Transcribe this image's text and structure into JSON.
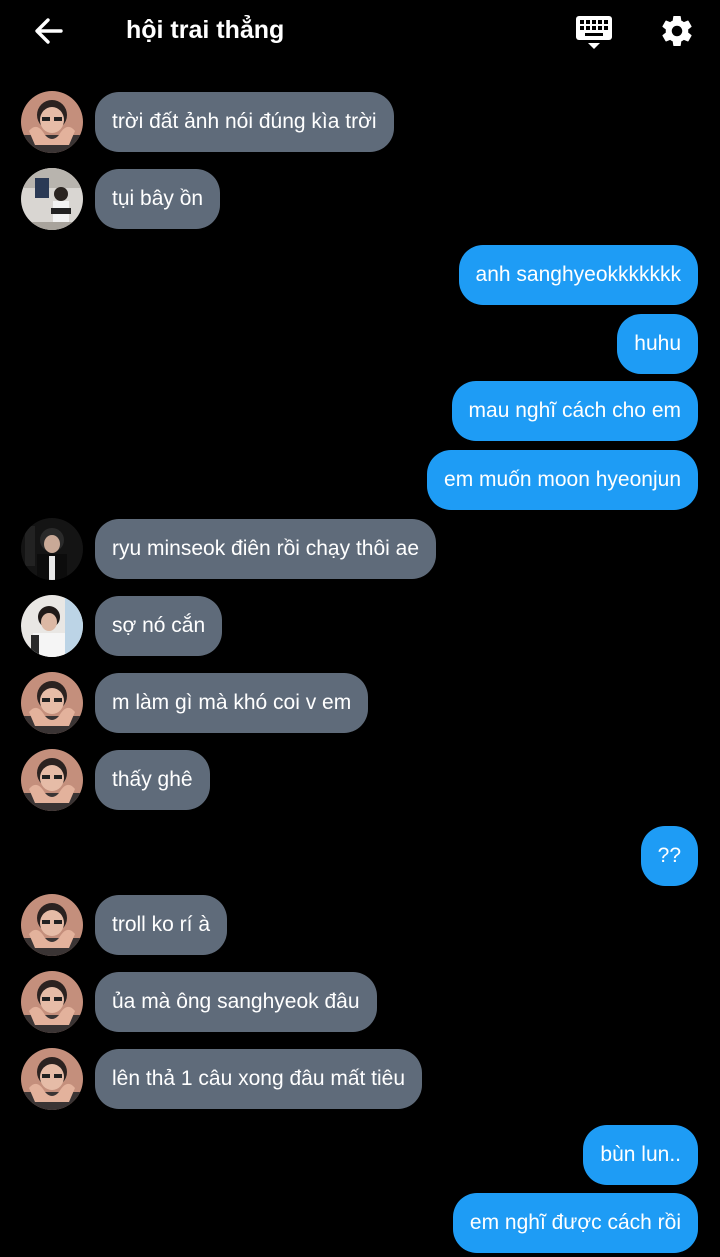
{
  "header": {
    "title": "hội trai thẳng",
    "back_icon": "arrow-left-icon",
    "keyboard_icon": "keyboard-icon",
    "settings_icon": "gear-icon"
  },
  "colors": {
    "background": "#000000",
    "incoming_bubble": "#5f6b7a",
    "outgoing_bubble": "#1e9cf5",
    "text": "#ffffff"
  },
  "messages": [
    {
      "direction": "in",
      "text": "trời đất ảnh nói đúng kìa trời",
      "avatar": "avatar-heart-hands"
    },
    {
      "direction": "in",
      "text": "tụi bây ồn",
      "avatar": "avatar-f1-store"
    },
    {
      "direction": "out",
      "text": "anh sanghyeokkkkkkk"
    },
    {
      "direction": "out",
      "text": "huhu"
    },
    {
      "direction": "out",
      "text": "mau nghĩ cách cho em"
    },
    {
      "direction": "out",
      "text": "em muốn moon hyeonjun"
    },
    {
      "direction": "in",
      "text": "ryu minseok điên rồi chạy thôi ae",
      "avatar": "avatar-dark-jacket"
    },
    {
      "direction": "in",
      "text": "sợ nó cắn",
      "avatar": "avatar-man-white"
    },
    {
      "direction": "in",
      "text": "m làm gì mà khó coi v em",
      "avatar": "avatar-heart-hands"
    },
    {
      "direction": "in",
      "text": "thấy ghê",
      "avatar": "avatar-heart-hands"
    },
    {
      "direction": "out",
      "text": "??"
    },
    {
      "direction": "in",
      "text": "troll ko rí à",
      "avatar": "avatar-heart-hands"
    },
    {
      "direction": "in",
      "text": "ủa mà ông sanghyeok đâu",
      "avatar": "avatar-heart-hands"
    },
    {
      "direction": "in",
      "text": "lên thả 1 câu xong đâu mất tiêu",
      "avatar": "avatar-heart-hands"
    },
    {
      "direction": "out",
      "text": "bùn lun.."
    },
    {
      "direction": "out",
      "text": "em nghĩ được cách rồi"
    }
  ]
}
